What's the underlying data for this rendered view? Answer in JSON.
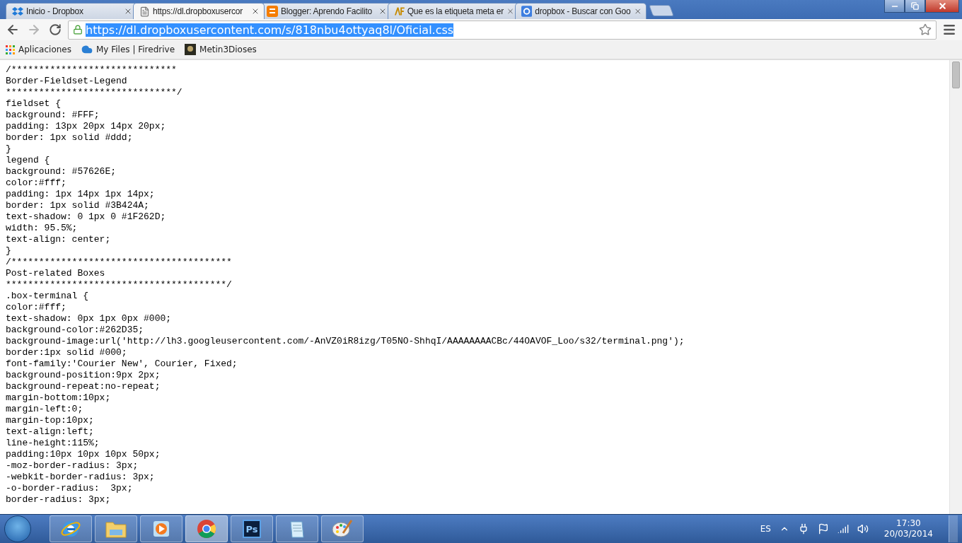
{
  "tabs": [
    {
      "title": "Inicio - Dropbox",
      "kind": "dropbox",
      "selected": false
    },
    {
      "title": "https://dl.dropboxusercor",
      "kind": "page",
      "selected": true
    },
    {
      "title": "Blogger: Aprendo Facilito",
      "kind": "blogger",
      "selected": false
    },
    {
      "title": "Que es la etiqueta meta er",
      "kind": "af",
      "selected": false
    },
    {
      "title": "dropbox - Buscar con Goo",
      "kind": "google",
      "selected": false
    }
  ],
  "address_bar": {
    "value": "https://dl.dropboxusercontent.com/s/818nbu4ottyaq8l/Oficial.css",
    "selected": true
  },
  "bookmarks": [
    {
      "label": "Aplicaciones",
      "kind": "apps"
    },
    {
      "label": "My Files | Firedrive",
      "kind": "cloud"
    },
    {
      "label": "Metin3Dioses",
      "kind": "image"
    }
  ],
  "code_lines": [
    "/******************************",
    "Border-Fieldset-Legend",
    "*******************************/",
    "fieldset {",
    "background: #FFF;",
    "padding: 13px 20px 14px 20px;",
    "border: 1px solid #ddd;",
    "}",
    "legend {",
    "background: #57626E;",
    "color:#fff;",
    "padding: 1px 14px 1px 14px;",
    "border: 1px solid #3B424A;",
    "text-shadow: 0 1px 0 #1F262D;",
    "width: 95.5%;",
    "text-align: center;",
    "}",
    "/****************************************",
    "Post-related Boxes",
    "****************************************/",
    ".box-terminal {",
    "color:#fff;",
    "text-shadow: 0px 1px 0px #000;",
    "background-color:#262D35;",
    "background-image:url('http://lh3.googleusercontent.com/-AnVZ0iR8izg/T05NO-ShhqI/AAAAAAAACBc/44OAVOF_Loo/s32/terminal.png');",
    "border:1px solid #000;",
    "font-family:'Courier New', Courier, Fixed;",
    "background-position:9px 2px;",
    "background-repeat:no-repeat;",
    "margin-bottom:10px;",
    "margin-left:0;",
    "margin-top:10px;",
    "text-align:left;",
    "line-height:115%;",
    "padding:10px 10px 10px 50px;",
    "-moz-border-radius: 3px;",
    "-webkit-border-radius: 3px;",
    "-o-border-radius:  3px;",
    "border-radius: 3px;"
  ],
  "taskbar": {
    "apps": [
      {
        "kind": "ie",
        "selected": false
      },
      {
        "kind": "folder",
        "selected": false
      },
      {
        "kind": "media",
        "selected": false
      },
      {
        "kind": "chrome",
        "selected": true
      },
      {
        "kind": "ps",
        "label": "Ps",
        "selected": false
      },
      {
        "kind": "notepad",
        "selected": false
      },
      {
        "kind": "paint",
        "selected": false
      }
    ],
    "language": "ES",
    "time": "17:30",
    "date": "20/03/2014"
  }
}
